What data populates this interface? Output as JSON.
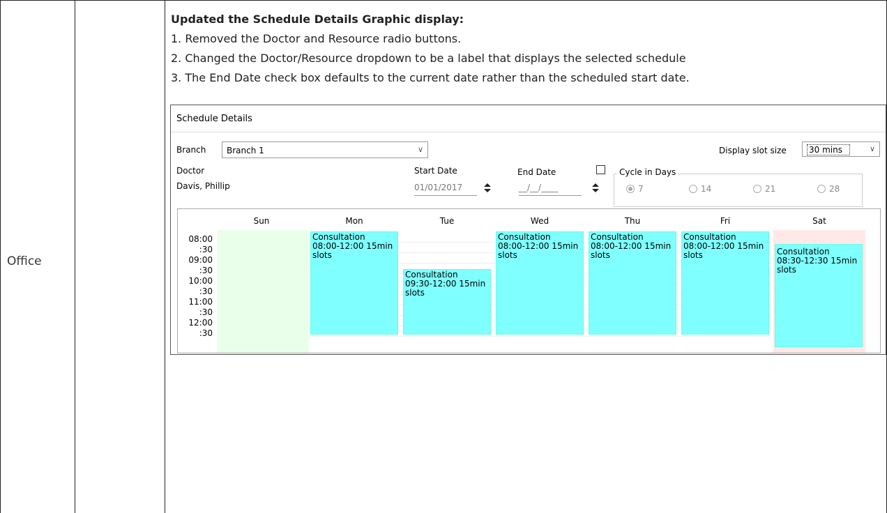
{
  "row": {
    "module": "Office"
  },
  "notes": {
    "heading": "Updated the Schedule Details Graphic display:",
    "items": [
      "1. Removed the Doctor and Resource radio buttons.",
      "2. Changed the Doctor/Resource dropdown to be a label that displays the selected schedule",
      "3. The End Date check box defaults to the current date rather than the scheduled start date."
    ]
  },
  "screen": {
    "title": "Schedule Details",
    "branch_label": "Branch",
    "branch_value": "Branch 1",
    "slot_label": "Display slot size",
    "slot_value": "30 mins",
    "doctor_label": "Doctor",
    "doctor_value": "Davis, Phillip",
    "start_label": "Start Date",
    "start_value": "01/01/2017",
    "end_label": "End Date",
    "end_value": "__/__/____",
    "cycle_label": "Cycle in Days",
    "cycle_options": [
      "7",
      "14",
      "21",
      "28"
    ],
    "cycle_selected": "7",
    "days": [
      "Sun",
      "Mon",
      "Tue",
      "Wed",
      "Thu",
      "Fri",
      "Sat"
    ],
    "times": [
      "08:00",
      ":30",
      "09:00",
      ":30",
      "10:00",
      ":30",
      "11:00",
      ":30",
      "12:00",
      ":30"
    ],
    "appointments": {
      "mon": [
        "Consultation",
        "08:00-12:00 15min",
        "slots"
      ],
      "tue": [
        "Consultation",
        "09:30-12:00 15min",
        "slots"
      ],
      "wed": [
        "Consultation",
        "08:00-12:00 15min",
        "slots"
      ],
      "thu": [
        "Consultation",
        "08:00-12:00 15min",
        "slots"
      ],
      "fri": [
        "Consultation",
        "08:00-12:00 15min",
        "slots"
      ],
      "sat": [
        "Consultation",
        "08:30-12:30 15min",
        "slots"
      ]
    }
  },
  "colors": {
    "appointment": "#7fffff",
    "sun_col": "#eaffea",
    "sat_col": "#ffe8e8"
  }
}
